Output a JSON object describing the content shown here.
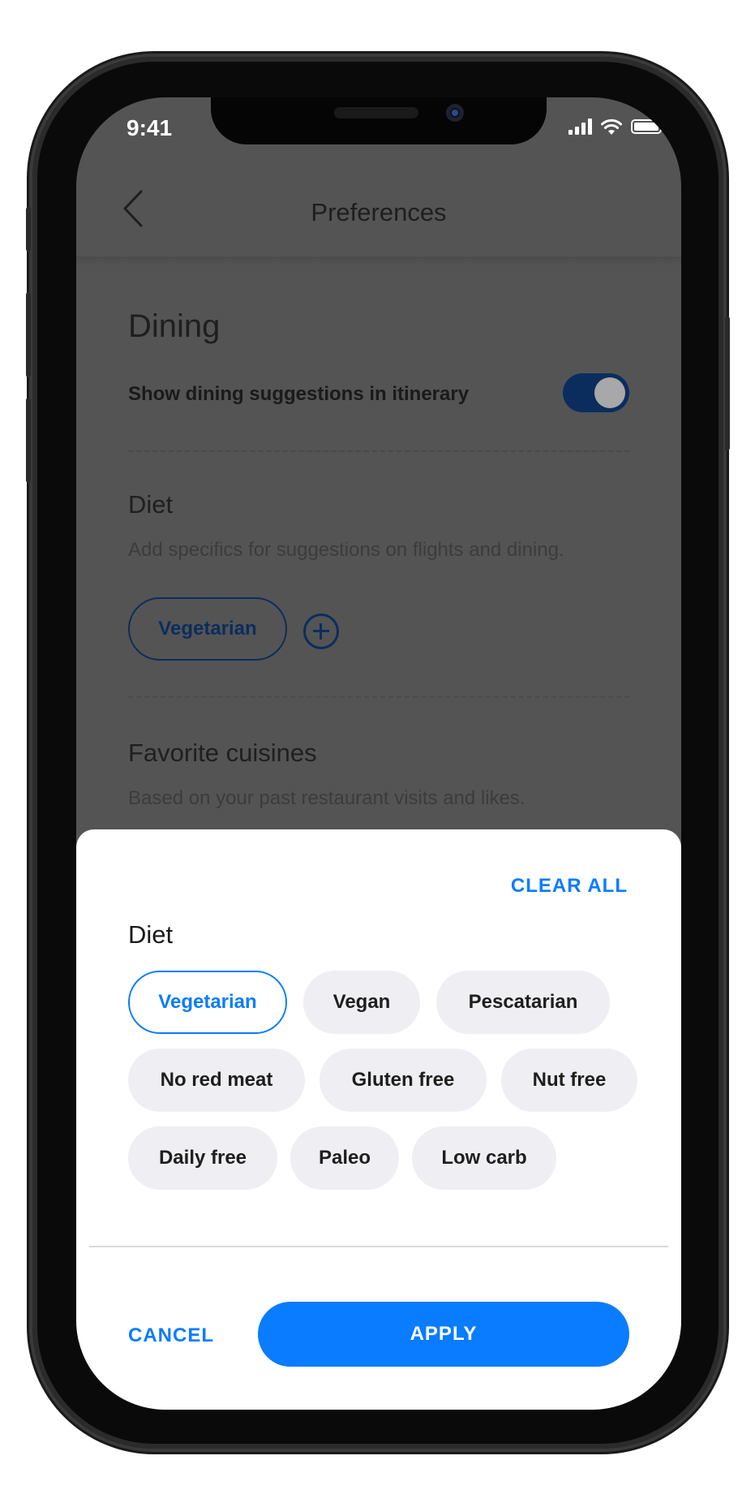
{
  "status_bar": {
    "time": "9:41"
  },
  "nav": {
    "title": "Preferences"
  },
  "dining": {
    "heading": "Dining",
    "toggle_label": "Show dining suggestions in itinerary",
    "toggle_on": true
  },
  "diet_section": {
    "heading": "Diet",
    "subtitle": "Add specifics for suggestions on flights and dining.",
    "selected_chip": "Vegetarian"
  },
  "cuisines_section": {
    "heading": "Favorite cuisines",
    "subtitle": "Based on your past restaurant visits and likes."
  },
  "sheet": {
    "clear_all": "CLEAR ALL",
    "title": "Diet",
    "chips": [
      {
        "label": "Vegetarian",
        "selected": true
      },
      {
        "label": "Vegan",
        "selected": false
      },
      {
        "label": "Pescatarian",
        "selected": false
      },
      {
        "label": "No red meat",
        "selected": false
      },
      {
        "label": "Gluten free",
        "selected": false
      },
      {
        "label": "Nut free",
        "selected": false
      },
      {
        "label": "Daily free",
        "selected": false
      },
      {
        "label": "Paleo",
        "selected": false
      },
      {
        "label": "Low carb",
        "selected": false
      }
    ],
    "cancel": "CANCEL",
    "apply": "APPLY"
  },
  "colors": {
    "accent": "#0a7cff",
    "chip_bg": "#efeff3",
    "overlay_bg": "#545454"
  },
  "icons": [
    "back-arrow-icon",
    "add-icon",
    "signal-icon",
    "wifi-icon",
    "battery-icon"
  ]
}
